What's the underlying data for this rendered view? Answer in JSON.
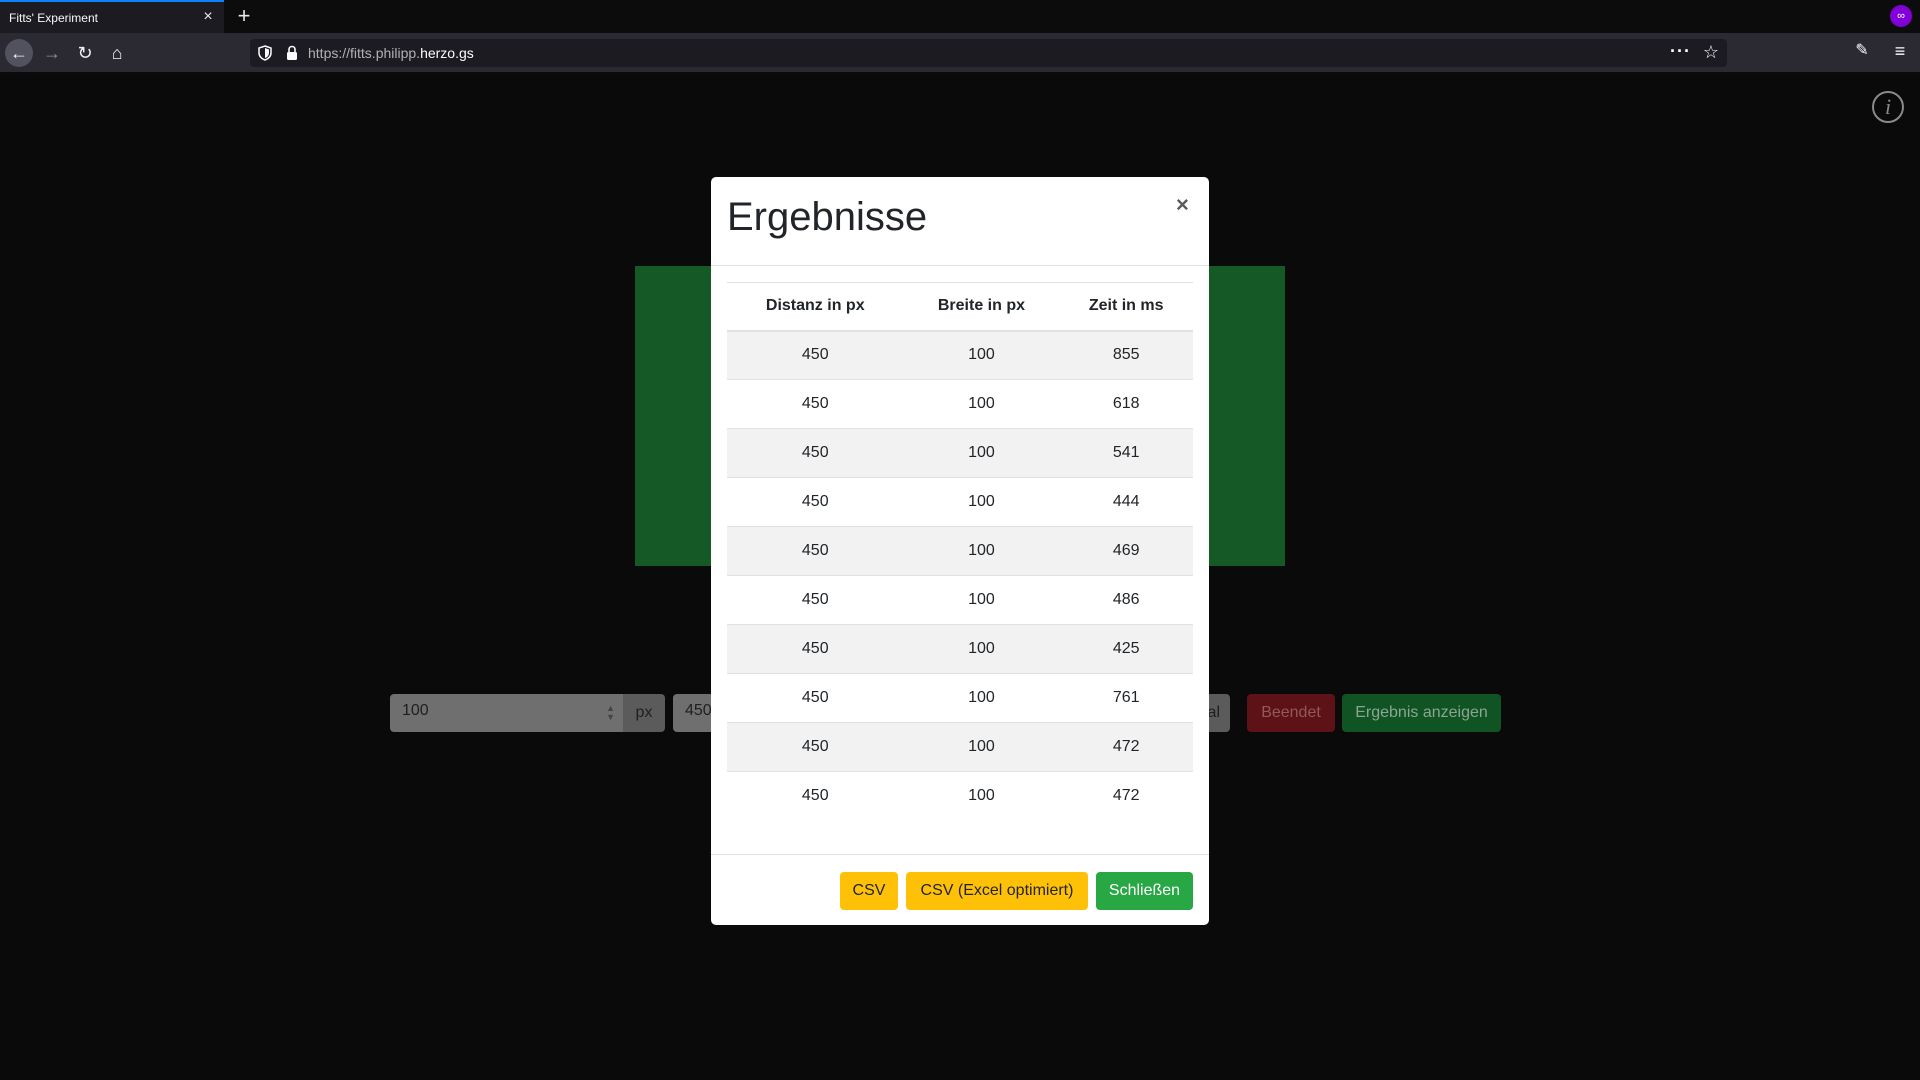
{
  "browser": {
    "tab_title": "Fitts' Experiment",
    "tab_close": "×",
    "new_tab": "+",
    "url_prefix": "https://fitts.philipp.",
    "url_domain": "herzo.gs",
    "more_icon": "···",
    "star_icon": "☆",
    "back_icon": "←",
    "forward_icon": "→",
    "reload_icon": "↻",
    "home_icon": "⌂",
    "tools_icon": "✎",
    "menu_icon": "≡",
    "private_icon": "∞"
  },
  "page": {
    "info_icon": "i",
    "controls": {
      "width_value": "100",
      "width_unit": "px",
      "distance_value": "450",
      "repeat_unit": "Mal",
      "finished_label": "Beendet",
      "show_result_label": "Ergebnis anzeigen"
    }
  },
  "modal": {
    "title": "Ergebnisse",
    "close_icon": "×",
    "columns": [
      "Distanz in px",
      "Breite in px",
      "Zeit in ms"
    ],
    "rows": [
      [
        "450",
        "100",
        "855"
      ],
      [
        "450",
        "100",
        "618"
      ],
      [
        "450",
        "100",
        "541"
      ],
      [
        "450",
        "100",
        "444"
      ],
      [
        "450",
        "100",
        "469"
      ],
      [
        "450",
        "100",
        "486"
      ],
      [
        "450",
        "100",
        "425"
      ],
      [
        "450",
        "100",
        "761"
      ],
      [
        "450",
        "100",
        "472"
      ],
      [
        "450",
        "100",
        "472"
      ]
    ],
    "buttons": {
      "csv": "CSV",
      "csv_excel": "CSV (Excel optimiert)",
      "close": "Schließen"
    }
  }
}
